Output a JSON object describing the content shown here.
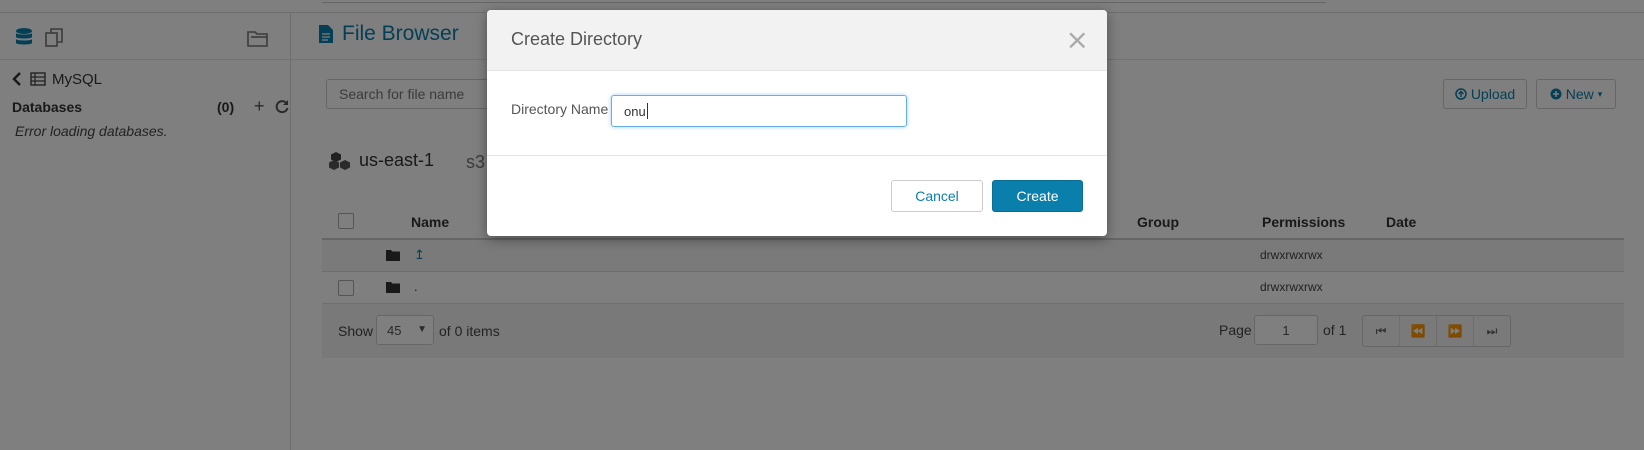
{
  "left_panel": {
    "icons": [
      "database-icon",
      "copy-icon",
      "folder-open-icon"
    ],
    "back_label": "MySQL",
    "databases_title": "Databases",
    "databases_count": "(0)",
    "add_symbol": "+",
    "error_text": "Error loading databases."
  },
  "file_browser": {
    "title": "File Browser",
    "search_placeholder": "Search for file name",
    "upload_label": "Upload",
    "new_label": "New",
    "crumb_region": "us-east-1",
    "crumb_next": "s3",
    "table": {
      "columns": {
        "name": "Name",
        "group": "Group",
        "permissions": "Permissions",
        "date": "Date"
      },
      "rows": [
        {
          "name": "↥",
          "permissions": "drwxrwxrwx"
        },
        {
          "name": ".",
          "permissions": "drwxrwxrwx"
        }
      ]
    },
    "footer": {
      "show_label": "Show",
      "page_size": "45",
      "items_text": "of 0 items",
      "page_label": "Page",
      "page_value": "1",
      "page_of": "of 1"
    }
  },
  "modal": {
    "title": "Create Directory",
    "close_symbol": "×",
    "field_label": "Directory Name",
    "field_value": "onu",
    "cancel_label": "Cancel",
    "create_label": "Create"
  },
  "colors": {
    "accent": "#0b7fab",
    "overlay": "rgba(0,0,0,0.5)"
  }
}
